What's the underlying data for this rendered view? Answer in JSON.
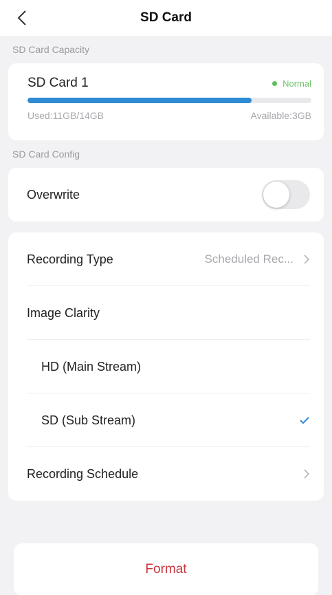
{
  "header": {
    "title": "SD Card"
  },
  "capacity": {
    "section_label": "SD Card Capacity",
    "card_name": "SD Card 1",
    "status": "Normal",
    "status_color": "#5cc05a",
    "used_text": "Used:11GB/14GB",
    "available_text": "Available:3GB",
    "used_fraction": 0.79,
    "progress_color": "#2e8bd6"
  },
  "config": {
    "section_label": "SD Card Config",
    "overwrite": {
      "label": "Overwrite",
      "enabled": false
    },
    "recording_type": {
      "label": "Recording Type",
      "value": "Scheduled Rec..."
    },
    "image_clarity": {
      "label": "Image Clarity",
      "options": [
        {
          "label": "HD (Main Stream)",
          "selected": false
        },
        {
          "label": "SD (Sub Stream)",
          "selected": true
        }
      ]
    },
    "recording_schedule": {
      "label": "Recording Schedule"
    }
  },
  "format": {
    "label": "Format",
    "color": "#c9363e"
  },
  "icons": {
    "back": "chevron-left-icon",
    "chevron": "chevron-right-icon",
    "check": "checkmark-icon"
  }
}
